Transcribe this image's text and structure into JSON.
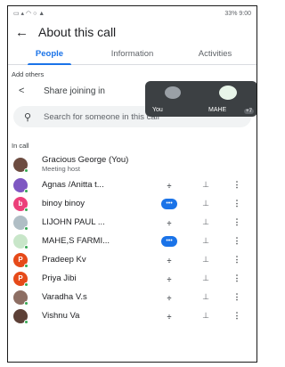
{
  "status": {
    "left_text": "",
    "right_text": "33% 9:00"
  },
  "header": {
    "title": "About this call"
  },
  "tabs": [
    {
      "label": "People",
      "active": true
    },
    {
      "label": "Information",
      "active": false
    },
    {
      "label": "Activities",
      "active": false
    }
  ],
  "add_others": {
    "label": "Add others",
    "share_label": "Share joining in"
  },
  "search": {
    "placeholder": "Search for someone in this call"
  },
  "in_call": {
    "label": "In call",
    "host": {
      "name": "Gracious George (You)",
      "role": "Meeting host"
    },
    "participants": [
      {
        "name": "Agnas /Anitta t...",
        "initial": "",
        "color": "#7e57c2",
        "state": "muted"
      },
      {
        "name": "binoy binoy",
        "initial": "b",
        "color": "#ec407a",
        "state": "speaking"
      },
      {
        "name": "LIJOHN PAUL ...",
        "initial": "",
        "color": "#b0bec5",
        "state": "muted"
      },
      {
        "name": "MAHE,S FARMI...",
        "initial": "",
        "color": "#c8e6c9",
        "state": "speaking"
      },
      {
        "name": "Pradeep Kv",
        "initial": "P",
        "color": "#e64a19",
        "state": "muted"
      },
      {
        "name": "Priya Jibi",
        "initial": "P",
        "color": "#e64a19",
        "state": "muted"
      },
      {
        "name": "Varadha V.s",
        "initial": "",
        "color": "#8d6e63",
        "state": "muted"
      },
      {
        "name": "Vishnu Va",
        "initial": "",
        "color": "#5d4037",
        "state": "muted"
      }
    ]
  },
  "overlay": {
    "tiles": [
      {
        "label": "You"
      },
      {
        "label": "MAHE",
        "badge": "+7"
      }
    ]
  },
  "colors": {
    "accent": "#1a73e8",
    "online": "#34a853"
  }
}
